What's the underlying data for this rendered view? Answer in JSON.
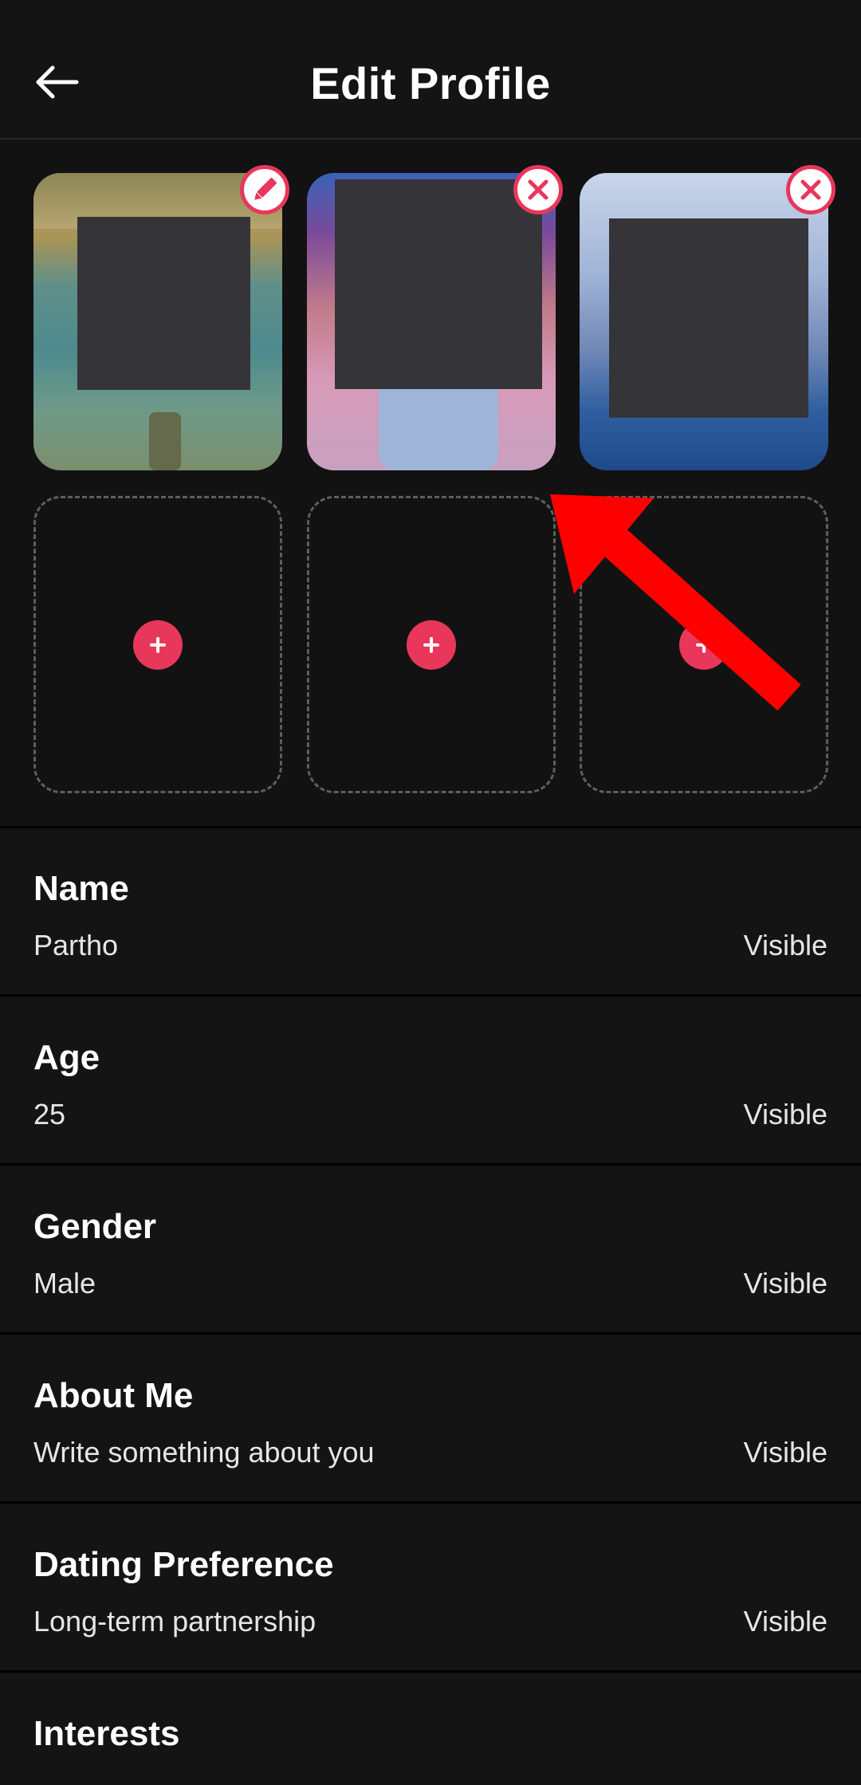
{
  "header": {
    "title": "Edit Profile",
    "back_icon": "arrow-left-icon"
  },
  "photos": [
    {
      "kind": "photo",
      "badge": "pencil-icon",
      "scene": "person standing in shallow water, face redacted"
    },
    {
      "kind": "photo",
      "badge": "close-icon",
      "scene": "person in light shirt indoors, face redacted"
    },
    {
      "kind": "photo",
      "badge": "close-icon",
      "scene": "person in pool under cloudy sky, face redacted"
    },
    {
      "kind": "empty",
      "action": "plus-icon"
    },
    {
      "kind": "empty",
      "action": "plus-icon"
    },
    {
      "kind": "empty",
      "action": "plus-icon"
    }
  ],
  "fields": [
    {
      "label": "Name",
      "value": "Partho",
      "visibility": "Visible"
    },
    {
      "label": "Age",
      "value": "25",
      "visibility": "Visible"
    },
    {
      "label": "Gender",
      "value": "Male",
      "visibility": "Visible"
    },
    {
      "label": "About Me",
      "value": "Write something about you",
      "visibility": "Visible"
    },
    {
      "label": "Dating Preference",
      "value": "Long-term partnership",
      "visibility": "Visible"
    },
    {
      "label": "Interests",
      "value": "",
      "visibility": ""
    }
  ],
  "colors": {
    "accent": "#e8375b",
    "background": "#121212",
    "surface": "#141415",
    "annotation_arrow": "#ff0000",
    "redaction": "#353438"
  }
}
